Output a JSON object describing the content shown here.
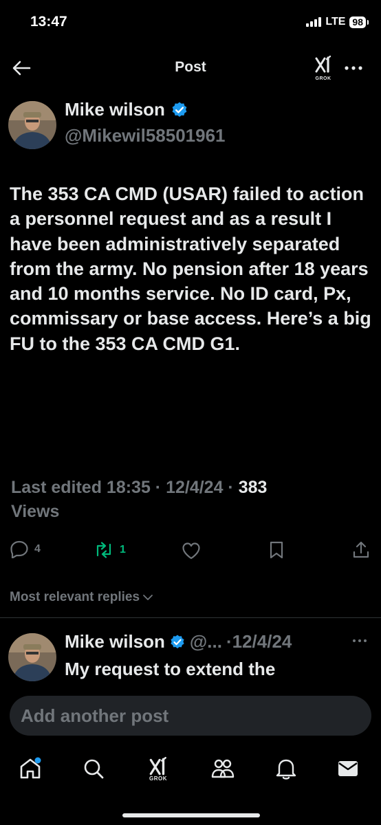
{
  "status_bar": {
    "time": "13:47",
    "network": "LTE",
    "battery": "98"
  },
  "header": {
    "title": "Post",
    "grok_label": "GROK"
  },
  "post": {
    "author_name": "Mike wilson",
    "author_handle": "@Mikewil58501961",
    "text": "The 353 CA CMD (USAR) failed to action a personnel request and as a result I have been administratively separated from the army.  No pension after 18 years and 10 months service. No ID card, Px, commissary or base access. Here’s a big FU to the 353 CA CMD G1.",
    "edited": "Last edited 18:35 · 12/4/24",
    "views_count": "383",
    "views_label": "Views",
    "replies": "4",
    "reposts": "1"
  },
  "replies_sort": "Most relevant replies",
  "reply": {
    "author_name": "Mike wilson",
    "handle_truncated": "@...",
    "date": "·12/4/24",
    "text": "My request to extend the"
  },
  "composer": {
    "placeholder": "Add another post"
  },
  "colors": {
    "background": "#000000",
    "text": "#e7e9ea",
    "muted": "#71767b",
    "verified": "#1d9bf0",
    "repost": "#00ba7c",
    "notification_dot": "#1d9bf0"
  },
  "icons": {
    "header": [
      "back-arrow-icon",
      "grok-icon",
      "more-icon"
    ],
    "actions": [
      "reply-icon",
      "repost-icon",
      "like-icon",
      "bookmark-icon",
      "share-icon"
    ],
    "tabs": [
      "home-icon",
      "search-icon",
      "grok-icon",
      "communities-icon",
      "notifications-icon",
      "messages-icon"
    ]
  }
}
